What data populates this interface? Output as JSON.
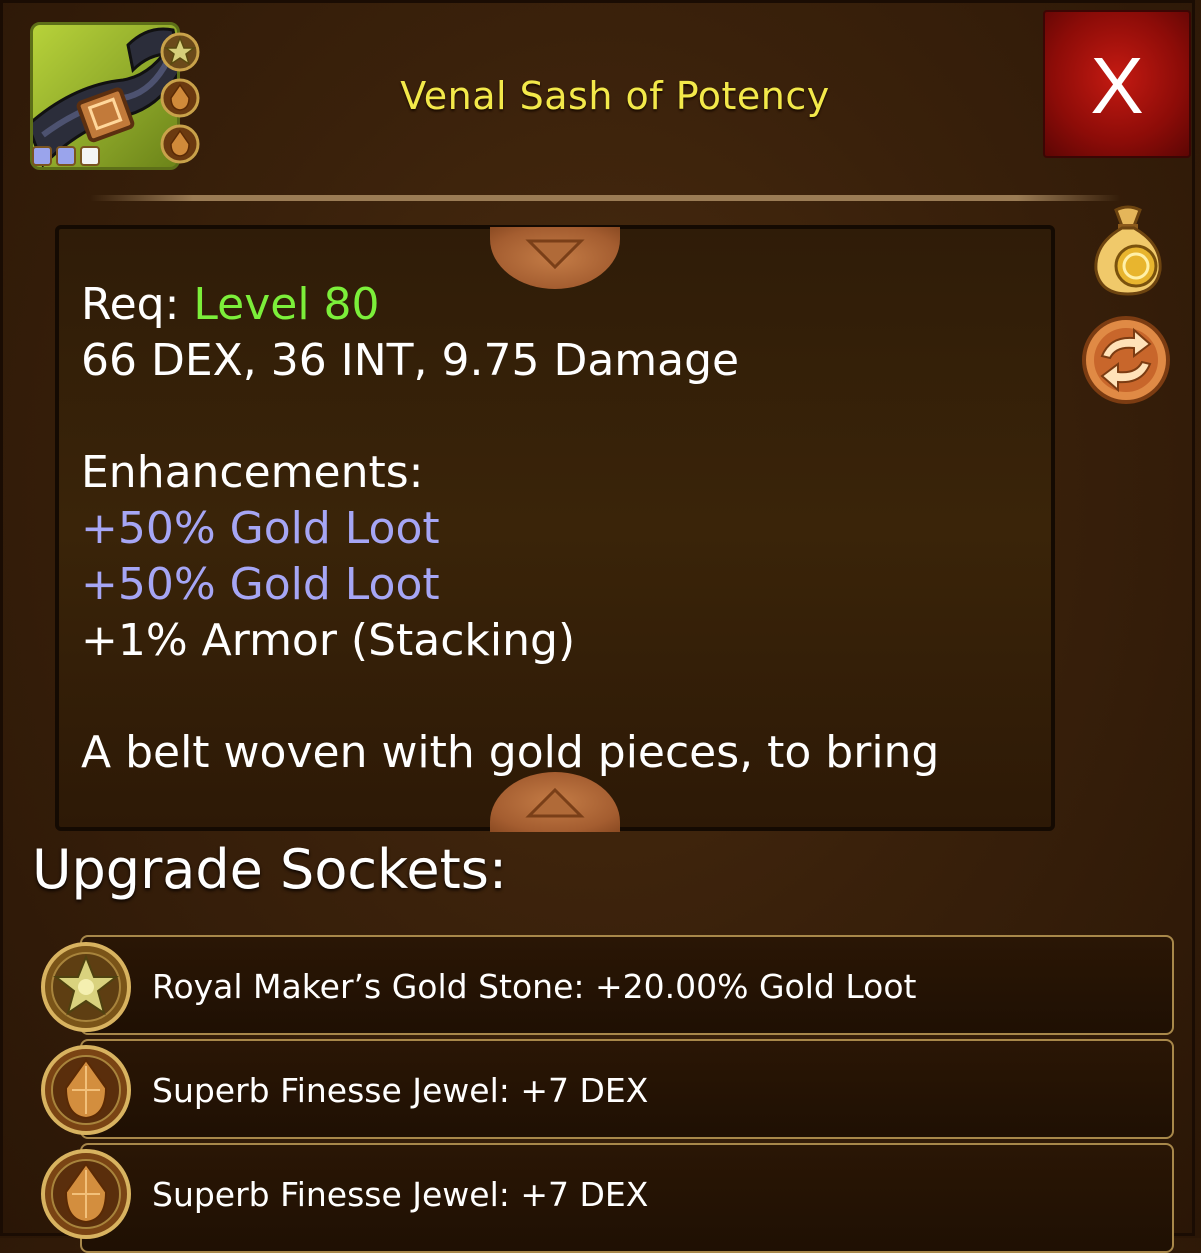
{
  "item": {
    "name": "Venal Sash of Potency",
    "icon": "belt-icon",
    "rarity_pips": [
      "blue",
      "blue",
      "white"
    ],
    "mini_sockets": [
      "gold-stone-icon",
      "finesse-jewel-icon",
      "finesse-jewel-icon"
    ]
  },
  "close_button": {
    "label": "X"
  },
  "description": {
    "req_label": "Req:",
    "req_level": "Level 80",
    "stats": "66 DEX, 36 INT, 9.75 Damage",
    "enhancements_label": "Enhancements:",
    "enhancements": [
      "+50% Gold Loot",
      "+50% Gold Loot",
      "+1% Armor (Stacking)"
    ],
    "flavor": "A belt woven with gold pieces, to bring"
  },
  "side_actions": {
    "sell": "gold-bag-icon",
    "swap": "swap-icon"
  },
  "upgrade_sockets": {
    "title": "Upgrade Sockets:",
    "items": [
      {
        "icon": "gold-stone-icon",
        "label": "Royal Maker’s Gold Stone: +20.00% Gold Loot"
      },
      {
        "icon": "finesse-jewel-icon",
        "label": "Superb Finesse Jewel: +7 DEX"
      },
      {
        "icon": "finesse-jewel-icon",
        "label": "Superb Finesse Jewel: +7 DEX"
      }
    ]
  },
  "colors": {
    "title": "#f3e94a",
    "level": "#7cef3a",
    "enhancement_gold": "#a6a6f5",
    "close_bg": "#b0140e"
  }
}
